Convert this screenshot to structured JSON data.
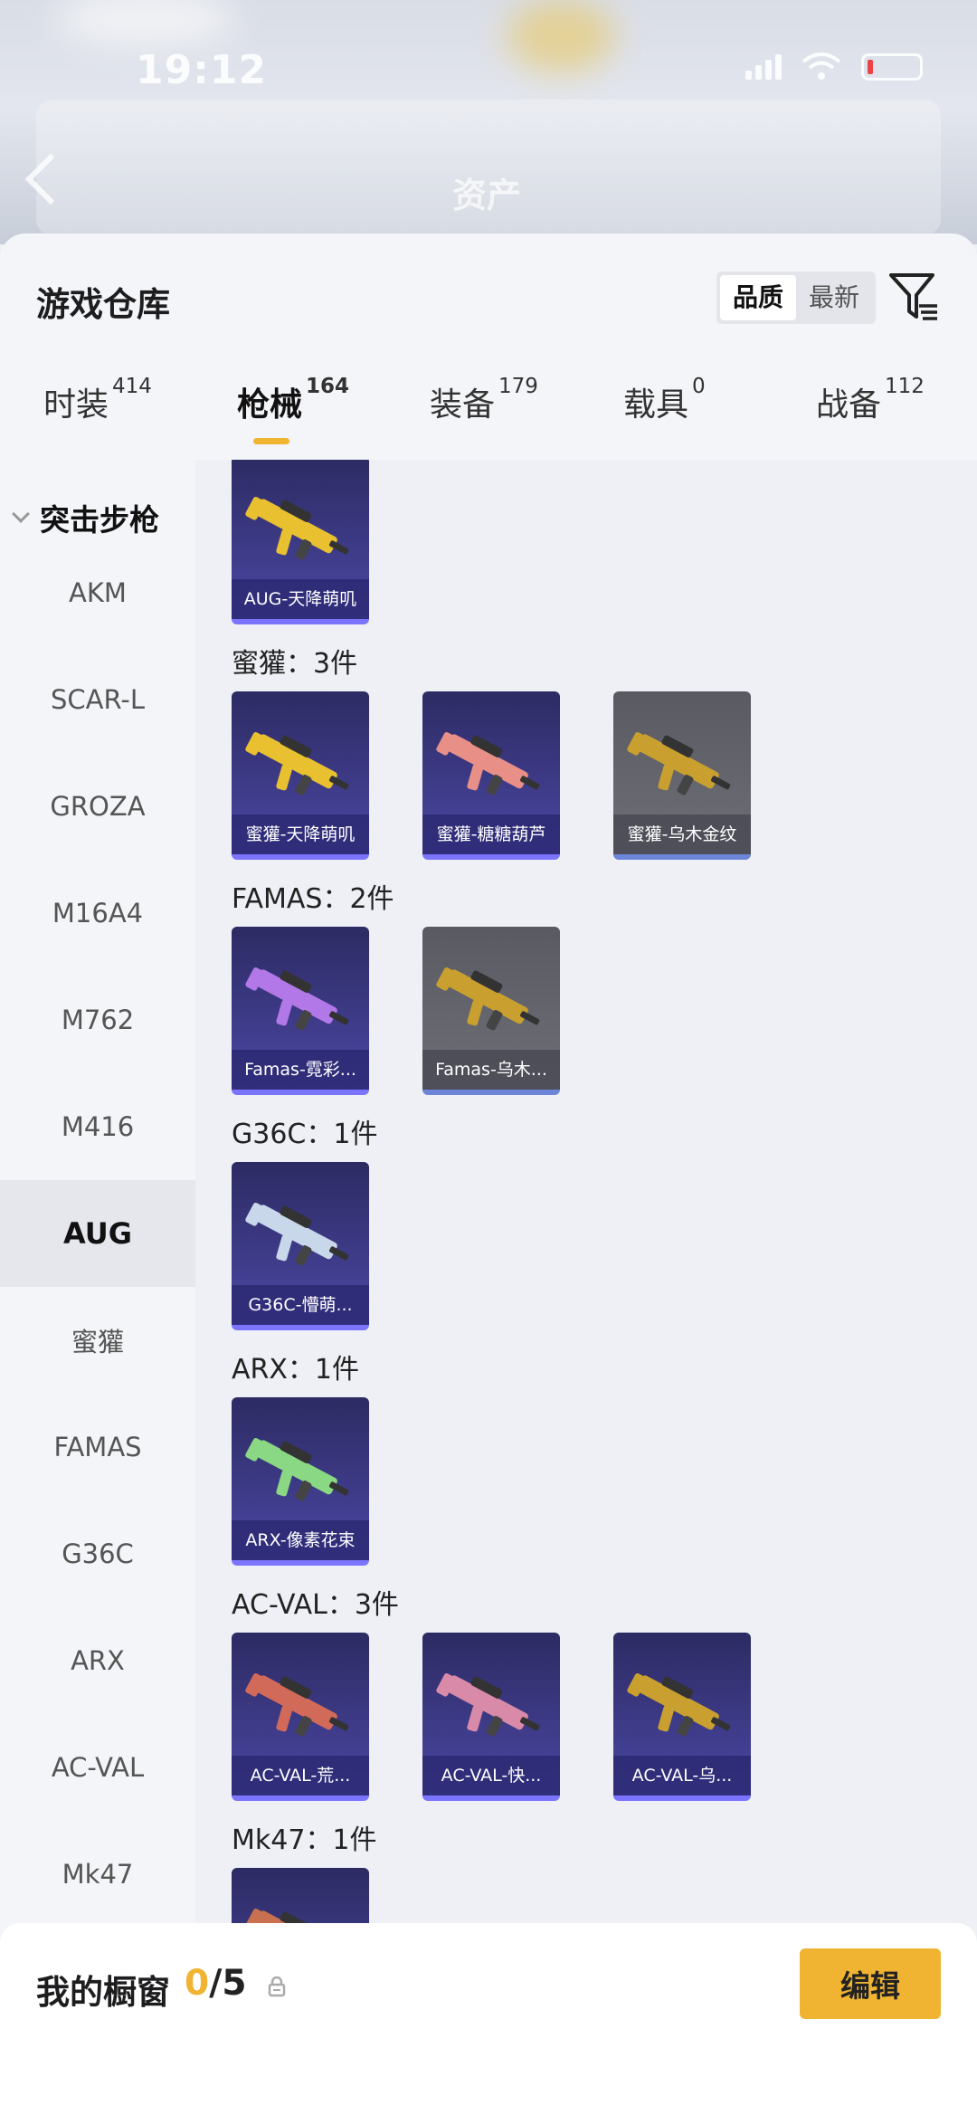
{
  "status": {
    "time": "19:12"
  },
  "header": {
    "blurred_title": "资产"
  },
  "sheet": {
    "title": "游戏仓库",
    "sort_options": [
      "品质",
      "最新"
    ],
    "sort_selected": "品质",
    "filter_icon": "filter-icon"
  },
  "tabs": [
    {
      "label": "时装",
      "count": "414"
    },
    {
      "label": "枪械",
      "count": "164"
    },
    {
      "label": "装备",
      "count": "179"
    },
    {
      "label": "载具",
      "count": "0"
    },
    {
      "label": "战备",
      "count": "112"
    }
  ],
  "active_tab": "枪械",
  "sidebar": {
    "header": "突击步枪",
    "items": [
      "AKM",
      "SCAR-L",
      "GROZA",
      "M16A4",
      "M762",
      "M416",
      "AUG",
      "蜜獾",
      "FAMAS",
      "G36C",
      "ARX",
      "AC-VAL",
      "Mk47"
    ],
    "active": "AUG"
  },
  "groups": [
    {
      "label": "",
      "items": [
        {
          "name": "AUG-天降萌叽",
          "color": "#e8c030"
        }
      ]
    },
    {
      "label": "蜜獾：3件",
      "items": [
        {
          "name": "蜜獾-天降萌叽",
          "color": "#e8c030"
        },
        {
          "name": "蜜獾-糖糖葫芦",
          "color": "#e89088"
        },
        {
          "name": "蜜獾-乌木金纹",
          "color": "#c9a030"
        }
      ]
    },
    {
      "label": "FAMAS：2件",
      "items": [
        {
          "name": "Famas-霓彩...",
          "color": "#b278e8"
        },
        {
          "name": "Famas-乌木...",
          "color": "#c9a030"
        }
      ]
    },
    {
      "label": "G36C：1件",
      "items": [
        {
          "name": "G36C-懵萌...",
          "color": "#c8d8ea"
        }
      ]
    },
    {
      "label": "ARX：1件",
      "items": [
        {
          "name": "ARX-像素花束",
          "color": "#8ad884"
        }
      ]
    },
    {
      "label": "AC-VAL：3件",
      "items": [
        {
          "name": "AC-VAL-荒...",
          "color": "#d26a5a"
        },
        {
          "name": "AC-VAL-快...",
          "color": "#d88aa8"
        },
        {
          "name": "AC-VAL-乌...",
          "color": "#c9a030"
        }
      ]
    },
    {
      "label": "Mk47：1件",
      "items": [
        {
          "name": "",
          "color": "#c87050"
        }
      ]
    }
  ],
  "footer": {
    "title": "我的橱窗",
    "current": "0",
    "total": "/5",
    "edit_label": "编辑"
  },
  "colors": {
    "accent": "#f0b432",
    "card_purple": "#3d3a86",
    "card_gray": "#606168"
  }
}
